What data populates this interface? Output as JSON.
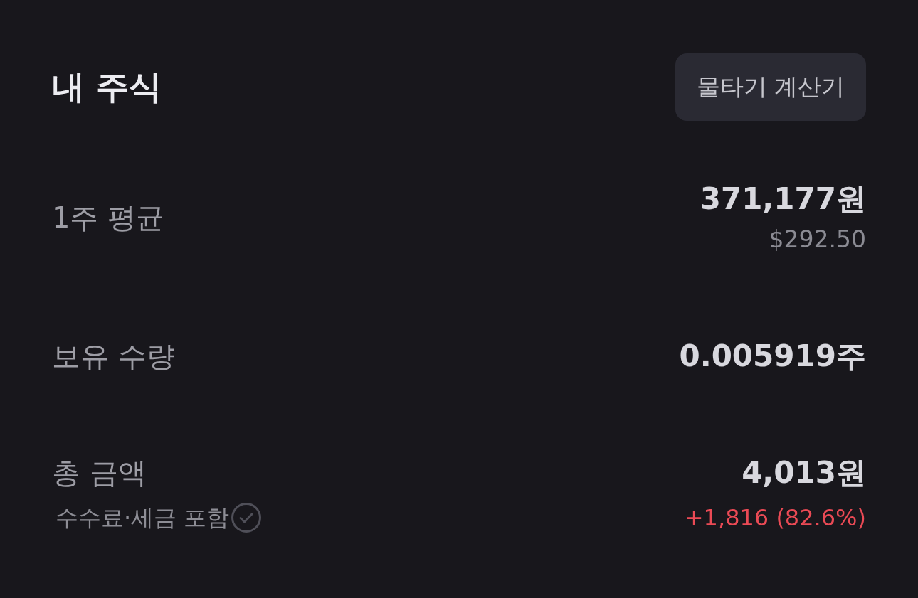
{
  "header": {
    "title": "내 주식",
    "button": "물타기 계산기"
  },
  "rows": [
    {
      "label": "1주 평균",
      "value": "371,177원",
      "sub_value": "$292.50"
    },
    {
      "label": "보유 수량",
      "value": "0.005919주"
    },
    {
      "label": "총 금액",
      "note": "수수료·세금 포함",
      "value": "4,013원",
      "change": {
        "text": "+1,816 (82.6%)",
        "rising": true
      }
    }
  ]
}
